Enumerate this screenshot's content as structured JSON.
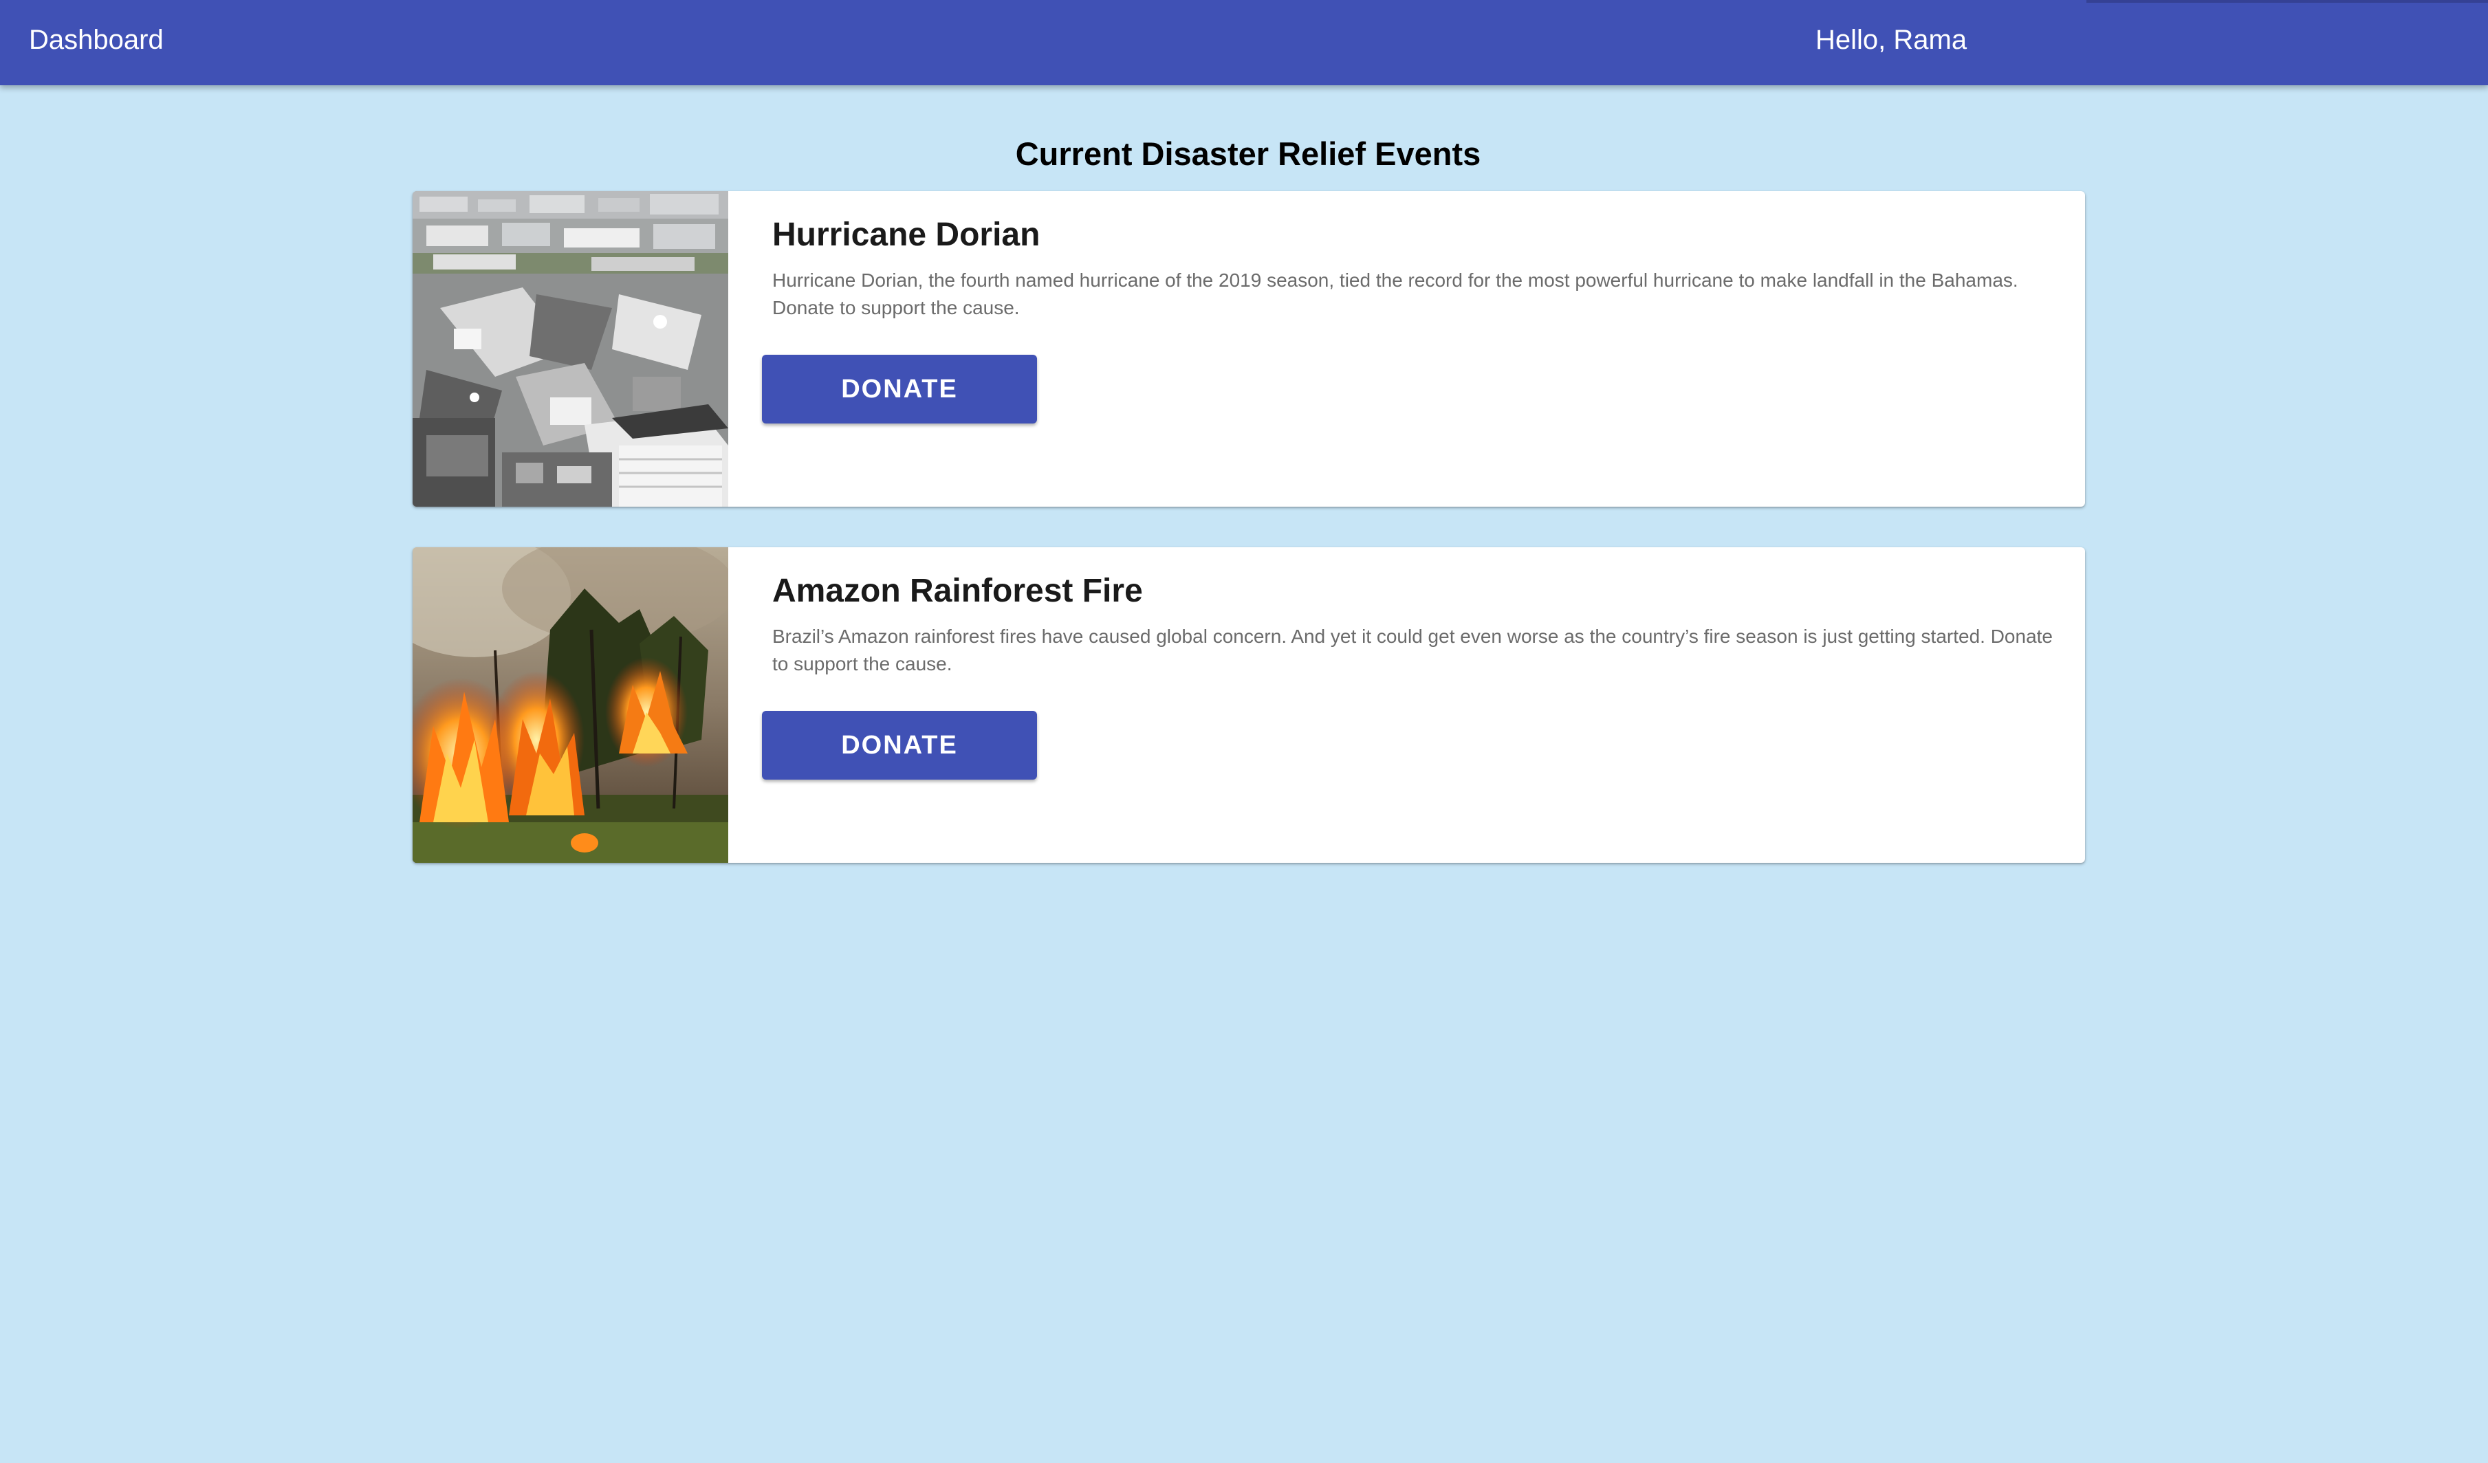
{
  "header": {
    "brand": "Dashboard",
    "greeting": "Hello, Rama"
  },
  "page": {
    "title": "Current Disaster Relief Events"
  },
  "events": [
    {
      "title": "Hurricane Dorian",
      "description": "Hurricane Dorian, the fourth named hurricane of the 2019 season, tied the record for the most powerful hurricane to make landfall in the Bahamas. Donate to support the cause.",
      "button_label": "DONATE",
      "image": "hurricane-debris-photo"
    },
    {
      "title": "Amazon Rainforest Fire",
      "description": "Brazil’s Amazon rainforest fires have caused global concern. And yet it could get even worse as the country’s fire season is just getting started. Donate to support the cause.",
      "button_label": "DONATE",
      "image": "forest-fire-photo"
    }
  ],
  "colors": {
    "appbar": "#4051b5",
    "background": "#c7e5f6",
    "card": "#ffffff",
    "button": "#4051b5"
  }
}
